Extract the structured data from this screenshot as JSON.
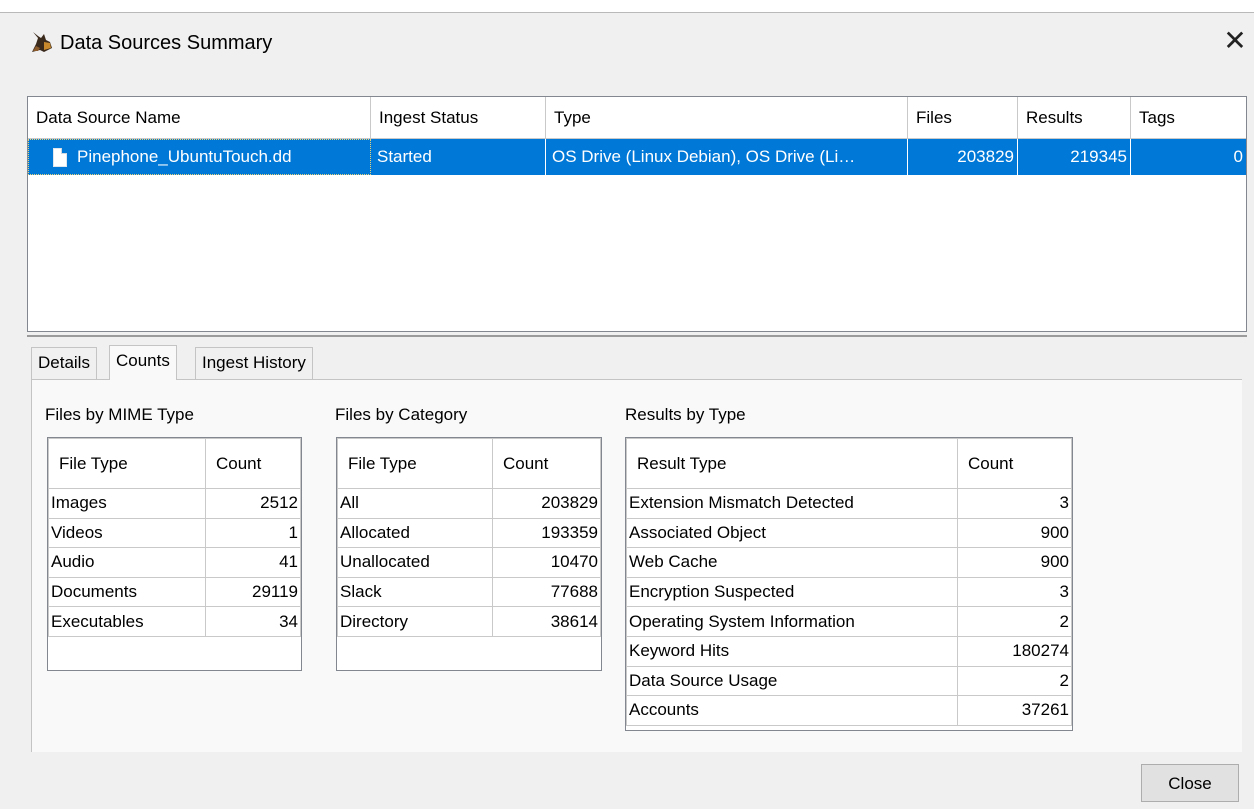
{
  "window": {
    "title": "Data Sources Summary",
    "app_icon": "autopsy-dog-icon",
    "close_glyph": "✕"
  },
  "data_sources": {
    "columns": [
      "Data Source Name",
      "Ingest Status",
      "Type",
      "Files",
      "Results",
      "Tags"
    ],
    "rows": [
      {
        "name": "Pinephone_UbuntuTouch.dd",
        "ingest_status": "Started",
        "type": "OS Drive (Linux Debian), OS Drive (Li…",
        "files": "203829",
        "results": "219345",
        "tags": "0"
      }
    ]
  },
  "tabs": [
    "Details",
    "Counts",
    "Ingest History"
  ],
  "active_tab": "Counts",
  "files_by_mime": {
    "label": "Files by MIME Type",
    "headers": [
      "File Type",
      "Count"
    ],
    "rows": [
      [
        "Images",
        "2512"
      ],
      [
        "Videos",
        "1"
      ],
      [
        "Audio",
        "41"
      ],
      [
        "Documents",
        "29119"
      ],
      [
        "Executables",
        "34"
      ]
    ]
  },
  "files_by_category": {
    "label": "Files by Category",
    "headers": [
      "File Type",
      "Count"
    ],
    "rows": [
      [
        "All",
        "203829"
      ],
      [
        "Allocated",
        "193359"
      ],
      [
        "Unallocated",
        "10470"
      ],
      [
        "Slack",
        "77688"
      ],
      [
        "Directory",
        "38614"
      ]
    ]
  },
  "results_by_type": {
    "label": "Results by Type",
    "headers": [
      "Result Type",
      "Count"
    ],
    "rows": [
      [
        "Extension Mismatch Detected",
        "3"
      ],
      [
        "Associated Object",
        "900"
      ],
      [
        "Web Cache",
        "900"
      ],
      [
        "Encryption Suspected",
        "3"
      ],
      [
        "Operating System Information",
        "2"
      ],
      [
        "Keyword Hits",
        "180274"
      ],
      [
        "Data Source Usage",
        "2"
      ],
      [
        "Accounts",
        "37261"
      ]
    ]
  },
  "buttons": {
    "close_label": "Close"
  },
  "colors": {
    "selection": "#0078d7",
    "background": "#f0f0f0"
  }
}
